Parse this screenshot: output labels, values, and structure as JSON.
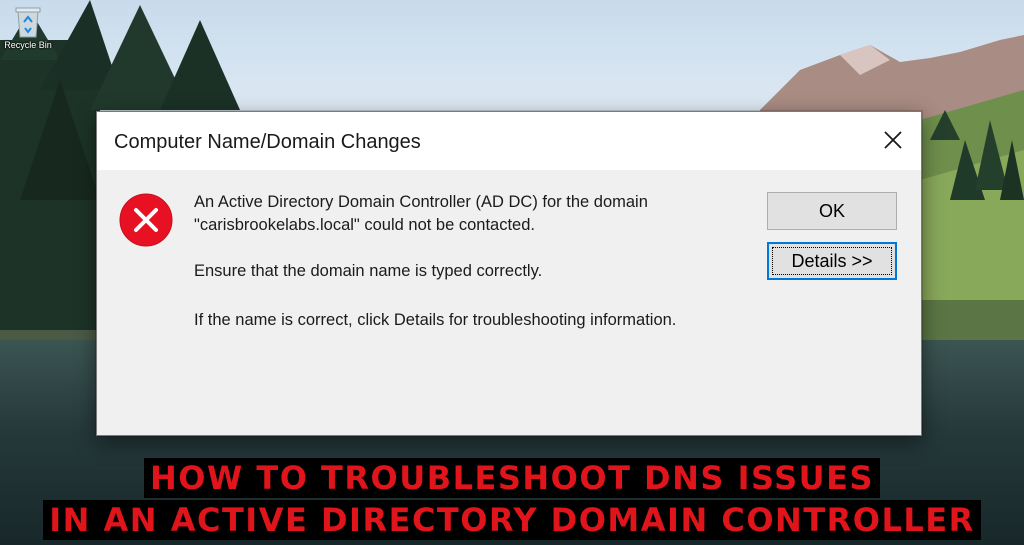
{
  "desktop": {
    "recycle_bin_label": "Recycle Bin"
  },
  "dialog": {
    "title": "Computer Name/Domain Changes",
    "close_icon": "close-icon",
    "status_icon": "error-icon",
    "message_line1": "An Active Directory Domain Controller (AD DC) for the domain",
    "message_line2": "\"carisbrookelabs.local\" could not be contacted.",
    "message_line3": "Ensure that the domain name is typed correctly.",
    "message_line4": "If the name is correct, click Details for troubleshooting information.",
    "ok_label": "OK",
    "details_label": "Details >>"
  },
  "caption": {
    "line1": "HOW TO TROUBLESHOOT DNS ISSUES",
    "line2": "IN AN ACTIVE DIRECTORY DOMAIN CONTROLLER"
  },
  "colors": {
    "error_red": "#e81123",
    "focus_blue": "#0078d7",
    "caption_red": "#e0141b"
  }
}
